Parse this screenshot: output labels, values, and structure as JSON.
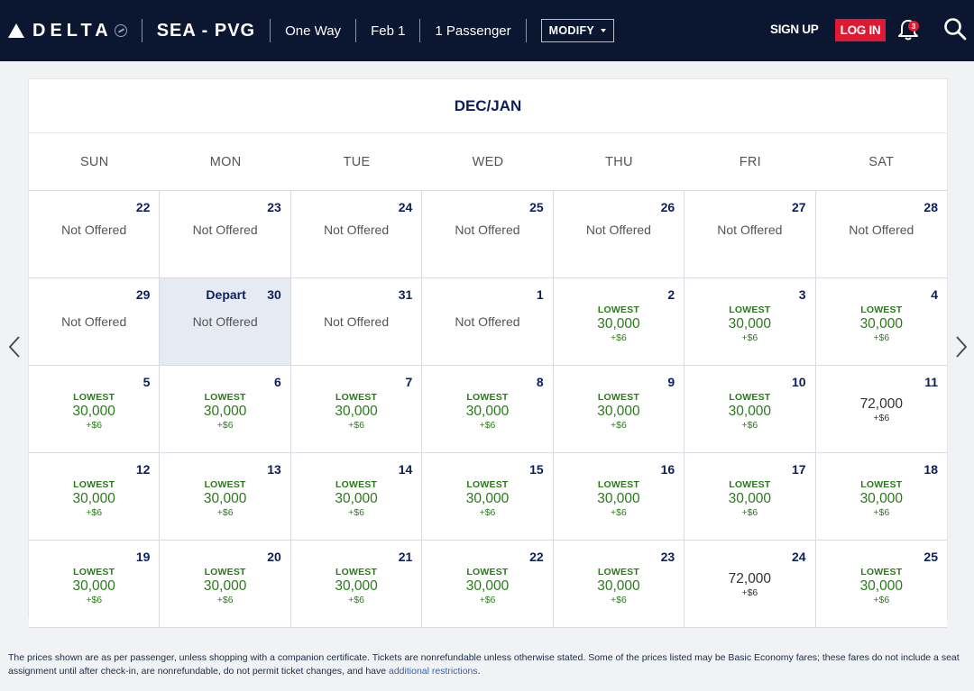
{
  "header": {
    "brand": "DELTA",
    "route": "SEA - PVG",
    "trip_type": "One Way",
    "date": "Feb 1",
    "passengers": "1 Passenger",
    "modify_label": "MODIFY",
    "signup_label": "SIGN UP",
    "login_label": "LOG IN",
    "notification_count": "3",
    "colors": {
      "bar": "#0b1630",
      "login": "#e01933"
    }
  },
  "calendar": {
    "month_label": "DEC/JAN",
    "weekdays": [
      "SUN",
      "MON",
      "TUE",
      "WED",
      "THU",
      "FRI",
      "SAT"
    ],
    "depart_label": "Depart",
    "not_offered_label": "Not Offered",
    "lowest_label": "LOWEST",
    "selected_day": "30",
    "days": [
      {
        "day": "22",
        "status": "not_offered"
      },
      {
        "day": "23",
        "status": "not_offered"
      },
      {
        "day": "24",
        "status": "not_offered"
      },
      {
        "day": "25",
        "status": "not_offered"
      },
      {
        "day": "26",
        "status": "not_offered"
      },
      {
        "day": "27",
        "status": "not_offered"
      },
      {
        "day": "28",
        "status": "not_offered"
      },
      {
        "day": "29",
        "status": "not_offered"
      },
      {
        "day": "30",
        "status": "not_offered",
        "selected": true
      },
      {
        "day": "31",
        "status": "not_offered"
      },
      {
        "day": "1",
        "status": "not_offered"
      },
      {
        "day": "2",
        "status": "lowest",
        "miles": "30,000",
        "fee": "+$6"
      },
      {
        "day": "3",
        "status": "lowest",
        "miles": "30,000",
        "fee": "+$6"
      },
      {
        "day": "4",
        "status": "lowest",
        "miles": "30,000",
        "fee": "+$6"
      },
      {
        "day": "5",
        "status": "lowest",
        "miles": "30,000",
        "fee": "+$6"
      },
      {
        "day": "6",
        "status": "lowest",
        "miles": "30,000",
        "fee": "+$6"
      },
      {
        "day": "7",
        "status": "lowest",
        "miles": "30,000",
        "fee": "+$6"
      },
      {
        "day": "8",
        "status": "lowest",
        "miles": "30,000",
        "fee": "+$6"
      },
      {
        "day": "9",
        "status": "lowest",
        "miles": "30,000",
        "fee": "+$6"
      },
      {
        "day": "10",
        "status": "lowest",
        "miles": "30,000",
        "fee": "+$6"
      },
      {
        "day": "11",
        "status": "fare",
        "miles": "72,000",
        "fee": "+$6"
      },
      {
        "day": "12",
        "status": "lowest",
        "miles": "30,000",
        "fee": "+$6"
      },
      {
        "day": "13",
        "status": "lowest",
        "miles": "30,000",
        "fee": "+$6"
      },
      {
        "day": "14",
        "status": "lowest",
        "miles": "30,000",
        "fee": "+$6"
      },
      {
        "day": "15",
        "status": "lowest",
        "miles": "30,000",
        "fee": "+$6"
      },
      {
        "day": "16",
        "status": "lowest",
        "miles": "30,000",
        "fee": "+$6"
      },
      {
        "day": "17",
        "status": "lowest",
        "miles": "30,000",
        "fee": "+$6"
      },
      {
        "day": "18",
        "status": "lowest",
        "miles": "30,000",
        "fee": "+$6"
      },
      {
        "day": "19",
        "status": "lowest",
        "miles": "30,000",
        "fee": "+$6"
      },
      {
        "day": "20",
        "status": "lowest",
        "miles": "30,000",
        "fee": "+$6"
      },
      {
        "day": "21",
        "status": "lowest",
        "miles": "30,000",
        "fee": "+$6"
      },
      {
        "day": "22",
        "status": "lowest",
        "miles": "30,000",
        "fee": "+$6"
      },
      {
        "day": "23",
        "status": "lowest",
        "miles": "30,000",
        "fee": "+$6"
      },
      {
        "day": "24",
        "status": "fare",
        "miles": "72,000",
        "fee": "+$6"
      },
      {
        "day": "25",
        "status": "lowest",
        "miles": "30,000",
        "fee": "+$6"
      }
    ],
    "colors": {
      "lowest": "#2a7a1a",
      "selected_bg": "#e6eaf2",
      "month": "#0b1f5c"
    }
  },
  "footnote": {
    "text": "The prices shown are as per passenger, unless shopping with a companion certificate. Tickets are nonrefundable unless otherwise stated. Some of the prices listed may be Basic Economy fares; these fares do not include a seat assignment until after check-in, are nonrefundable, do not permit ticket changes, and have ",
    "link_label": "additional restrictions",
    "end": "."
  }
}
